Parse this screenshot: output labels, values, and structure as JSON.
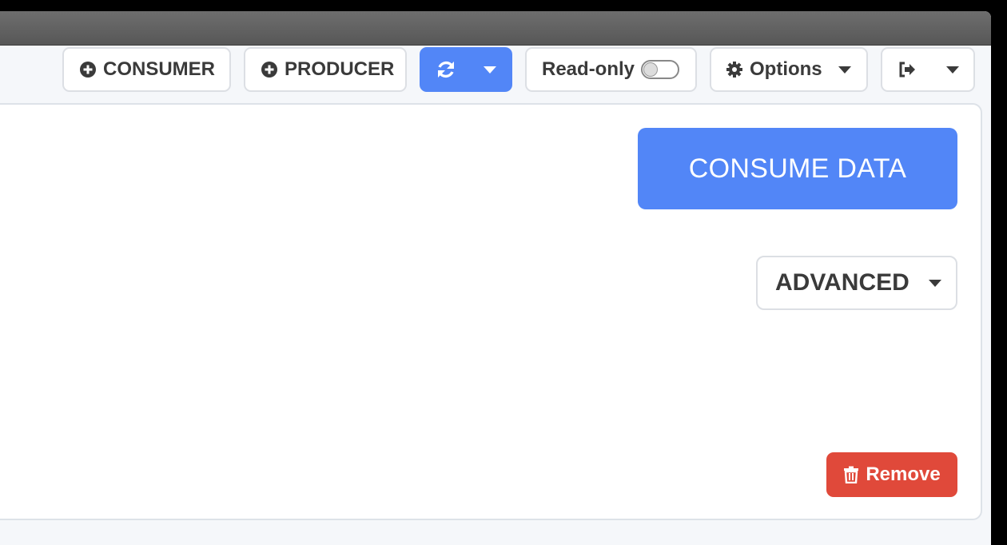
{
  "toolbar": {
    "consumer_label": "CONSUMER",
    "producer_label": "PRODUCER",
    "readonly_label": "Read-only",
    "readonly_enabled": false,
    "options_label": "Options"
  },
  "main": {
    "consume_label": "CONSUME DATA",
    "advanced_label": "ADVANCED",
    "remove_label": "Remove"
  },
  "colors": {
    "primary": "#5286f7",
    "danger": "#e0493a",
    "titlebar": "#636363"
  },
  "icons": [
    "plus-circle-icon",
    "refresh-icon",
    "chevron-down-icon",
    "gear-icon",
    "sign-out-icon",
    "trash-icon"
  ]
}
